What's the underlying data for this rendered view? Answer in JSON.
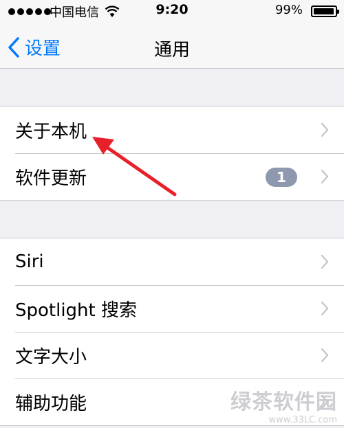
{
  "status_bar": {
    "carrier": "中国电信",
    "time": "9:20",
    "battery_percent": "99%"
  },
  "nav": {
    "back_label": "设置",
    "title": "通用"
  },
  "groups": [
    {
      "rows": [
        {
          "label": "关于本机"
        },
        {
          "label": "软件更新",
          "badge": "1"
        }
      ]
    },
    {
      "rows": [
        {
          "label": "Siri"
        },
        {
          "label": "Spotlight 搜索"
        },
        {
          "label": "文字大小"
        },
        {
          "label": "辅助功能"
        }
      ]
    }
  ],
  "watermark": {
    "name": "绿茶软件园",
    "url": "www.33LC.com"
  },
  "colors": {
    "accent": "#007aff",
    "annotation_arrow": "#e8202a",
    "badge": "#8e99b0"
  }
}
